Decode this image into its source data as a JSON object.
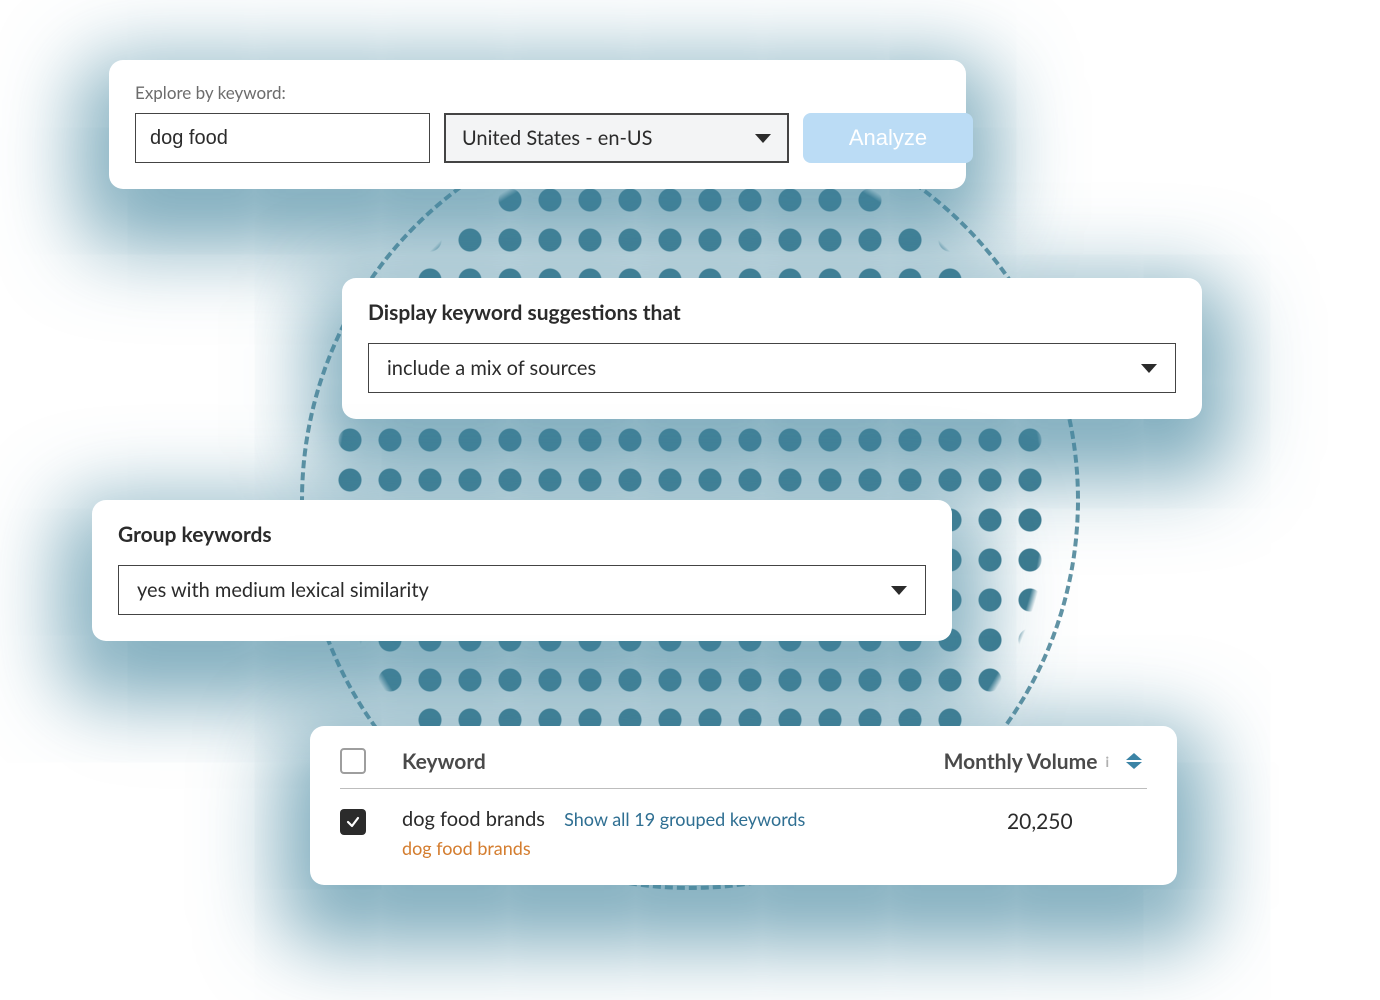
{
  "explore": {
    "label": "Explore by keyword:",
    "keyword_value": "dog food",
    "locale_value": "United States - en-US",
    "analyze_label": "Analyze"
  },
  "suggestions": {
    "heading": "Display keyword suggestions that",
    "value": "include a mix of sources"
  },
  "group": {
    "heading": "Group keywords",
    "value": "yes with medium lexical similarity"
  },
  "results": {
    "columns": {
      "keyword": "Keyword",
      "volume": "Monthly Volume"
    },
    "info_glyph": "i",
    "row": {
      "checked": "true",
      "keyword": "dog food brands",
      "show_all": "Show all 19 grouped keywords",
      "subkeyword": "dog food brands",
      "volume": "20,250"
    }
  }
}
